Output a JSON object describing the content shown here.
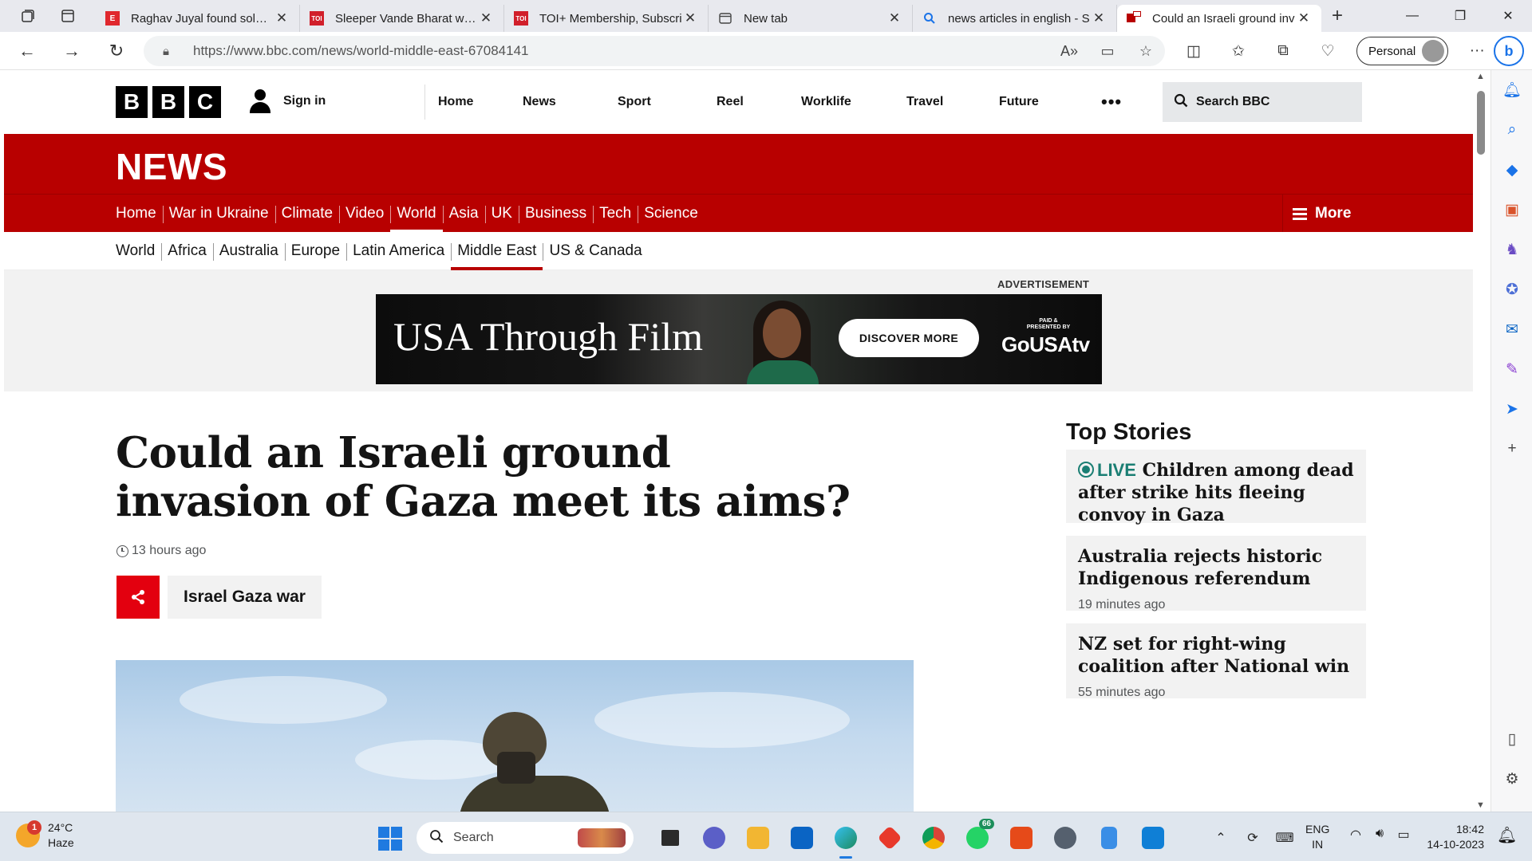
{
  "browser": {
    "tabs": [
      {
        "title": "Raghav Juyal found solace",
        "icon": "E",
        "color": "#e0282e"
      },
      {
        "title": "Sleeper Vande Bharat will c",
        "icon": "TOI",
        "color": "#d11f2a"
      },
      {
        "title": "TOI+ Membership, Subscri",
        "icon": "TOI",
        "color": "#d11f2a"
      },
      {
        "title": "New tab",
        "icon": "tab-icon",
        "color": "#555555"
      },
      {
        "title": "news articles in english - S",
        "icon": "search-icon",
        "color": "#1a73e8"
      },
      {
        "title": "Could an Israeli ground inv",
        "icon": "bbc-icon",
        "color": "#b80000",
        "active": true
      }
    ],
    "url": "https://www.bbc.com/news/world-middle-east-67084141",
    "profile_label": "Personal"
  },
  "bbc": {
    "sign_in": "Sign in",
    "top_nav": [
      "Home",
      "News",
      "Sport",
      "Reel",
      "Worklife",
      "Travel",
      "Future"
    ],
    "more_dots": "•••",
    "search_label": "Search BBC",
    "news_title": "NEWS",
    "section_nav": [
      "Home",
      "War in Ukraine",
      "Climate",
      "Video",
      "World",
      "Asia",
      "UK",
      "Business",
      "Tech",
      "Science"
    ],
    "section_selected": "World",
    "more_label": "More",
    "sub_nav": [
      "World",
      "Africa",
      "Australia",
      "Europe",
      "Latin America",
      "Middle East",
      "US & Canada"
    ],
    "sub_selected": "Middle East"
  },
  "ad": {
    "label": "ADVERTISEMENT",
    "title": "USA Through Film",
    "button": "DISCOVER MORE",
    "paid_line1": "PAID &",
    "paid_line2": "PRESENTED BY",
    "brand": "GoUSAtv"
  },
  "article": {
    "headline": "Could an Israeli ground invasion of Gaza meet its aims?",
    "timestamp": "13 hours ago",
    "topic": "Israel Gaza war"
  },
  "top_stories": {
    "title": "Top Stories",
    "items": [
      {
        "live": "LIVE",
        "headline": "Children among dead after strike hits fleeing convoy in Gaza",
        "time": ""
      },
      {
        "live": "",
        "headline": "Australia rejects historic Indigenous referendum",
        "time": "19 minutes ago"
      },
      {
        "live": "",
        "headline": "NZ set for right-wing coalition after National win",
        "time": "55 minutes ago"
      }
    ]
  },
  "taskbar": {
    "weather_temp": "24°C",
    "weather_desc": "Haze",
    "weather_badge": "1",
    "search_label": "Search",
    "whatsapp_badge": "66",
    "lang_line1": "ENG",
    "lang_line2": "IN",
    "time": "18:42",
    "date": "14-10-2023"
  }
}
